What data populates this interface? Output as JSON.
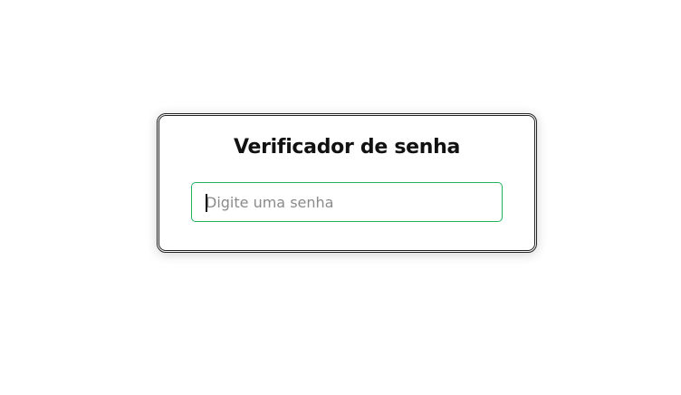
{
  "card": {
    "title": "Verificador de senha"
  },
  "password": {
    "value": "",
    "placeholder": "Digite uma senha"
  },
  "colors": {
    "input_border": "#22b35e",
    "card_border": "#222222",
    "title": "#111111"
  }
}
